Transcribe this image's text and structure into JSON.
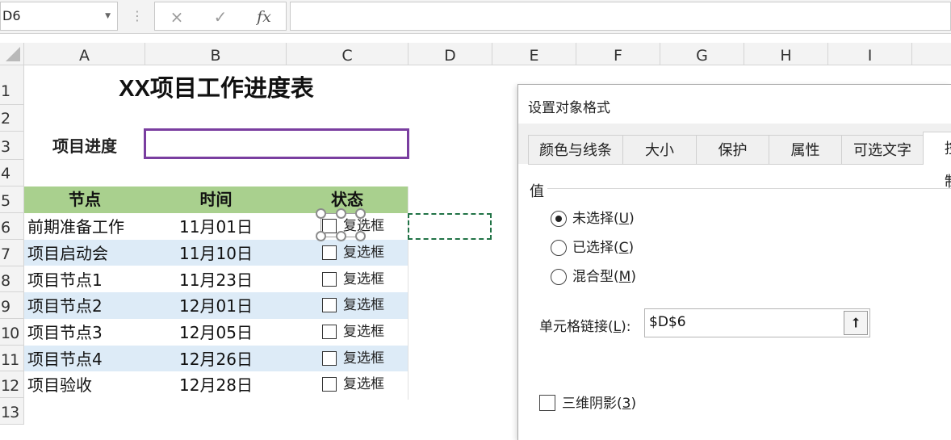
{
  "formula_bar": {
    "name_box": "D6",
    "separator": "⋮",
    "cancel_icon": "×",
    "enter_icon": "✓",
    "fx_label": "fx",
    "formula": ""
  },
  "columns": [
    "A",
    "B",
    "C",
    "D",
    "E",
    "F",
    "G",
    "H",
    "I"
  ],
  "rows": [
    "1",
    "2",
    "3",
    "4",
    "5",
    "6",
    "7",
    "8",
    "9",
    "10",
    "11",
    "12",
    "13"
  ],
  "sheet": {
    "title": "XX项目工作进度表",
    "progress_label": "项目进度",
    "headers": [
      "节点",
      "时间",
      "状态"
    ],
    "table": [
      {
        "node": "前期准备工作",
        "date": "11月01日",
        "checkbox": "复选框"
      },
      {
        "node": "项目启动会",
        "date": "11月10日",
        "checkbox": "复选框"
      },
      {
        "node": "项目节点1",
        "date": "11月23日",
        "checkbox": "复选框"
      },
      {
        "node": "项目节点2",
        "date": "12月01日",
        "checkbox": "复选框"
      },
      {
        "node": "项目节点3",
        "date": "12月05日",
        "checkbox": "复选框"
      },
      {
        "node": "项目节点4",
        "date": "12月26日",
        "checkbox": "复选框"
      },
      {
        "node": "项目验收",
        "date": "12月28日",
        "checkbox": "复选框"
      }
    ]
  },
  "dialog": {
    "title": "设置对象格式",
    "tabs": [
      "颜色与线条",
      "大小",
      "保护",
      "属性",
      "可选文字",
      "控制"
    ],
    "active_tab": "控制",
    "value_label": "值",
    "radios": [
      {
        "label": "未选择(",
        "key": "U",
        "suffix": ")",
        "selected": true
      },
      {
        "label": "已选择(",
        "key": "C",
        "suffix": ")",
        "selected": false
      },
      {
        "label": "混合型(",
        "key": "M",
        "suffix": ")",
        "selected": false
      }
    ],
    "cell_link_label": "单元格链接(",
    "cell_link_key": "L",
    "cell_link_suffix": "):",
    "cell_link_value": "$D$6",
    "collapse_icon": "🠕",
    "shading_label": "三维阴影(",
    "shading_key": "3",
    "shading_suffix": ")",
    "shading_checked": false
  },
  "colors": {
    "header_fill": "#a9d08e",
    "alt_row_fill": "#ddebf7",
    "progress_border": "#7a3ea0",
    "copy_marquee": "#217346"
  }
}
